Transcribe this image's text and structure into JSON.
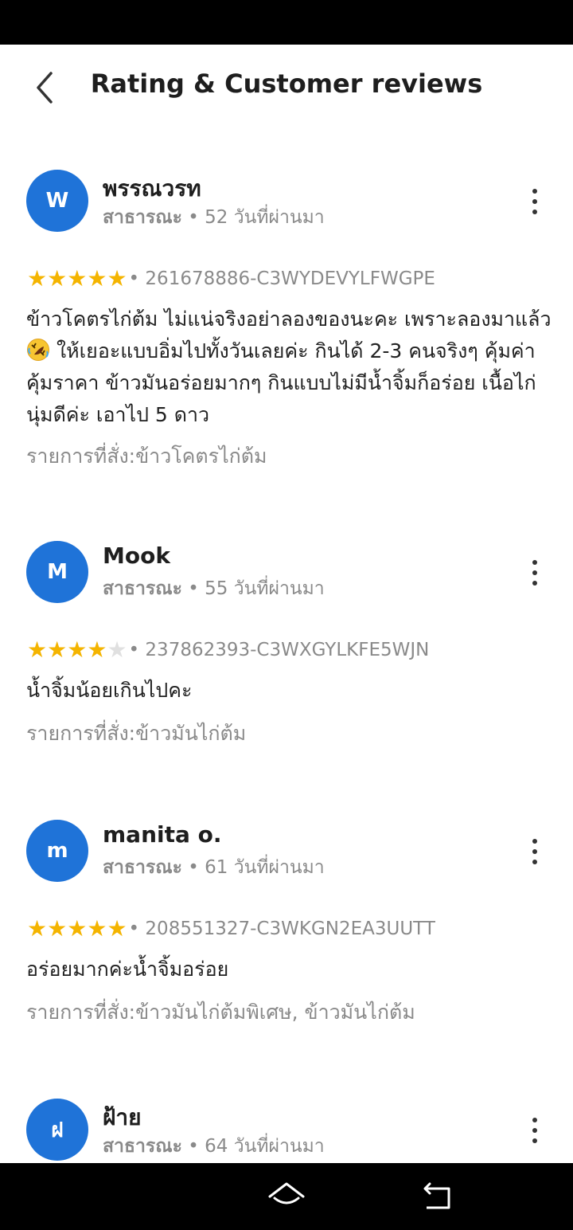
{
  "header": {
    "title": "Rating & Customer reviews"
  },
  "colors": {
    "avatar": "#1f73d8",
    "star_filled": "#f4b400",
    "star_empty": "#e0e0e0",
    "meta_text": "#8a8a8a"
  },
  "icons": {
    "back": "chevron-left-icon",
    "more": "more-vertical-icon",
    "star": "star-icon",
    "emoji": "rolling-laughing-emoji",
    "nav_home": "home-icon",
    "nav_back": "back-icon"
  },
  "reviews": [
    {
      "avatar_letter": "W",
      "name": "พรรณวรท",
      "role": "สาธารณะ",
      "sep": " • ",
      "age": "52 วันที่ผ่านมา",
      "rating": 5,
      "order_id": "• 261678886-C3WYDEVYLFWGPE",
      "text_before_emoji": "ข้าวโคตรไก่ต้ม ไม่แน่จริงอย่าลองของนะคะ เพราะลองมาแล้ว ",
      "text_after_emoji": " ให้เยอะแบบอิ่มไปทั้งวันเลยค่ะ กินได้ 2-3 คนจริงๆ คุ้มค่าคุ้มราคา ข้าวมันอร่อยมากๆ กินแบบไม่มีน้ำจิ้มก็อร่อย  เนื้อไก่นุ่มดีค่ะ เอาไป 5 ดาว",
      "items": "รายการที่สั่ง:ข้าวโคตรไก่ต้ม"
    },
    {
      "avatar_letter": "M",
      "name": "Mook",
      "role": "สาธารณะ",
      "sep": " • ",
      "age": "55 วันที่ผ่านมา",
      "rating": 4,
      "order_id": "• 237862393-C3WXGYLKFE5WJN",
      "text": "น้ำจิ้มน้อยเกินไปคะ",
      "items": "รายการที่สั่ง:ข้าวมันไก่ต้ม"
    },
    {
      "avatar_letter": "m",
      "name": "manita o.",
      "role": "สาธารณะ",
      "sep": " • ",
      "age": "61 วันที่ผ่านมา",
      "rating": 5,
      "order_id": "• 208551327-C3WKGN2EA3UUTT",
      "text": "อร่อยมากค่ะน้ำจิ้มอร่อย",
      "items": "รายการที่สั่ง:ข้าวมันไก่ต้มพิเศษ, ข้าวมันไก่ต้ม"
    },
    {
      "avatar_letter": "ฝ",
      "name": "ฝ้าย",
      "role": "สาธารณะ",
      "sep": " • ",
      "age": "64 วันที่ผ่านมา"
    }
  ]
}
